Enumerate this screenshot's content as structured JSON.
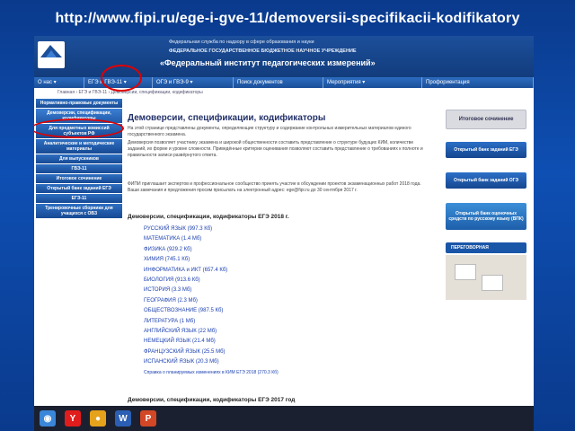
{
  "slide": {
    "title": "http://www.fipi.ru/ege-i-gve-11/demoversii-specifikacii-kodifikatory"
  },
  "header": {
    "logo_text": "ФИПИ",
    "line1": "Федеральная служба по надзору в сфере образования и науки",
    "line2": "ФЕДЕРАЛЬНОЕ ГОСУДАРСТВЕННОЕ БЮДЖЕТНОЕ НАУЧНОЕ УЧРЕЖДЕНИЕ",
    "line3": "«Федеральный институт педагогических измерений»"
  },
  "nav": {
    "items": [
      {
        "label": "О нас ▾"
      },
      {
        "label": "ЕГЭ и ГВЭ-11 ▾"
      },
      {
        "label": "ОГЭ и ГВЭ-9 ▾"
      },
      {
        "label": "Поиск документов"
      },
      {
        "label": "Мероприятия ▾"
      },
      {
        "label": "Профориентация"
      }
    ]
  },
  "breadcrumb": "Главная › ЕГЭ и ГВЭ-11 › Демоверсии, спецификации, кодификаторы",
  "sidebar": {
    "items": [
      {
        "label": "Нормативно-правовые документы"
      },
      {
        "label": "Демоверсии, спецификации, кодификаторы"
      },
      {
        "label": "Для предметных комиссий субъектов РФ"
      },
      {
        "label": "Аналитические и методические материалы"
      },
      {
        "label": "Для выпускников"
      },
      {
        "label": "ГВЭ-11"
      },
      {
        "label": "Итоговое сочинение"
      },
      {
        "label": "Открытый банк заданий ЕГЭ"
      },
      {
        "label": "ЕГЭ-11"
      },
      {
        "label": "Тренировочные сборники для учащихся с ОВЗ"
      }
    ]
  },
  "main": {
    "title": "Демоверсии, спецификации, кодификаторы",
    "paragraphs": [
      "На этой странице представлены документы, определяющие структуру и содержание контрольных измерительных материалов единого государственного экзамена.",
      "Демоверсия позволяет участнику экзамена и широкой общественности составить представление о структуре будущих КИМ, количестве заданий, их форме и уровне сложности. Приведённые критерии оценивания позволяют составить представление о требованиях к полноте и правильности записи развёрнутого ответа.",
      "ФИПИ приглашает экспертов и профессиональное сообщество принять участие в обсуждении проектов экзаменационных работ 2018 года. Ваши замечания и предложения просим присылать на электронный адрес: ege@fipi.ru до 30 сентября 2017 г."
    ],
    "section_2018": "Демоверсии, спецификации, кодификаторы ЕГЭ 2018 г.",
    "docs": [
      {
        "label": "РУССКИЙ ЯЗЫК (997.3 Кб)"
      },
      {
        "label": "МАТЕМАТИКА (1.4 Мб)"
      },
      {
        "label": "ФИЗИКА (929.2 Кб)"
      },
      {
        "label": "ХИМИЯ (745.1 Кб)"
      },
      {
        "label": "ИНФОРМАТИКА и ИКТ (657.4 Кб)"
      },
      {
        "label": "БИОЛОГИЯ (913.6 Кб)"
      },
      {
        "label": "ИСТОРИЯ (3.3 Мб)"
      },
      {
        "label": "ГЕОГРАФИЯ (2.3 Мб)"
      },
      {
        "label": "ОБЩЕСТВОЗНАНИЕ (987.5 Кб)"
      },
      {
        "label": "ЛИТЕРАТУРА (1 Мб)"
      },
      {
        "label": "АНГЛИЙСКИЙ ЯЗЫК (22 Мб)"
      },
      {
        "label": "НЕМЕЦКИЙ ЯЗЫК (21.4 Мб)"
      },
      {
        "label": "ФРАНЦУЗСКИЙ ЯЗЫК (25.5 Мб)"
      },
      {
        "label": "ИСПАНСКИЙ ЯЗЫК (20.3 Мб)"
      }
    ],
    "changes_link": "Справка о планируемых изменениях в КИМ ЕГЭ 2018 (270.3 Кб)",
    "section_2017": "Демоверсии, спецификации, кодификаторы ЕГЭ 2017 год"
  },
  "right_panel": {
    "essay": "Итоговое сочинение",
    "bank_ege": "Открытый банк заданий ЕГЭ",
    "bank_oge": "Открытый банк заданий ОГЭ",
    "bank_ovz": "Открытый банк оценочных средств по русскому языку (ВПК)",
    "pere": "ПЕРЕГОВОРНАЯ"
  },
  "taskbar": {
    "icons": [
      {
        "name": "start-icon",
        "glyph": "◉",
        "color": "#3a86d8"
      },
      {
        "name": "yandex-icon",
        "glyph": "Y",
        "color": "#e01c1c"
      },
      {
        "name": "chrome-icon",
        "glyph": "●",
        "color": "#e5a21b"
      },
      {
        "name": "word-icon",
        "glyph": "W",
        "color": "#2b5fb3"
      },
      {
        "name": "powerpoint-icon",
        "glyph": "P",
        "color": "#d24726"
      }
    ]
  }
}
